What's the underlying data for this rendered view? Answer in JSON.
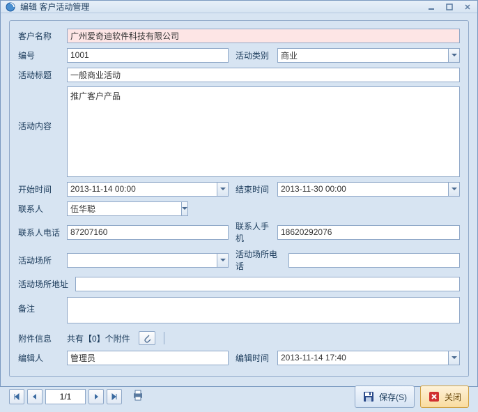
{
  "window": {
    "title": "编辑 客户活动管理"
  },
  "form": {
    "labels": {
      "customer_name": "客户名称",
      "number": "编号",
      "activity_type": "活动类别",
      "activity_title": "活动标题",
      "activity_content": "活动内容",
      "start_time": "开始时间",
      "end_time": "结束时间",
      "contact": "联系人",
      "contact_phone": "联系人电话",
      "contact_mobile": "联系人手机",
      "venue": "活动场所",
      "venue_phone": "活动场所电话",
      "venue_address": "活动场所地址",
      "remark": "备注",
      "attachment_info": "附件信息",
      "editor": "编辑人",
      "edit_time": "编辑时间"
    },
    "values": {
      "customer_name": "广州爱奇迪软件科技有限公司",
      "number": "1001",
      "activity_type": "商业",
      "activity_title": "一般商业活动",
      "activity_content": "推广客户产品",
      "start_time": "2013-11-14 00:00",
      "end_time": "2013-11-30 00:00",
      "contact": "伍华聪",
      "contact_phone": "87207160",
      "contact_mobile": "18620292076",
      "venue": "",
      "venue_phone": "",
      "venue_address": "",
      "remark": "",
      "editor": "管理员",
      "edit_time": "2013-11-14 17:40"
    },
    "attachment_text": "共有【0】个附件"
  },
  "footer": {
    "page": "1/1",
    "save": "保存(S)",
    "close": "关闭"
  }
}
